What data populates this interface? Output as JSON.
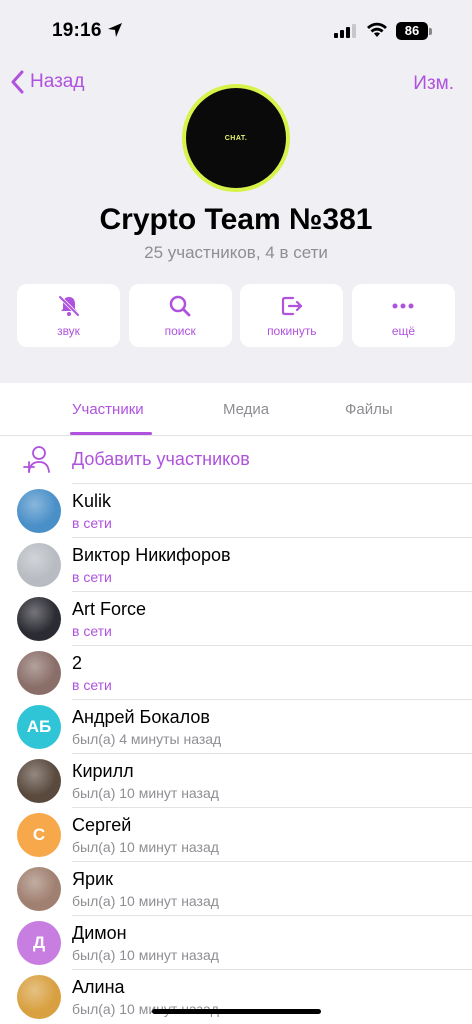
{
  "status_bar": {
    "time": "19:16",
    "battery": "86"
  },
  "nav": {
    "back_label": "Назад",
    "edit_label": "Изм."
  },
  "group": {
    "avatar_text": "CHAT.",
    "title": "Crypto Team №381",
    "subtitle": "25 участников, 4 в сети"
  },
  "actions": [
    {
      "label": "звук",
      "icon": "bell-slash-icon"
    },
    {
      "label": "поиск",
      "icon": "search-icon"
    },
    {
      "label": "покинуть",
      "icon": "leave-icon"
    },
    {
      "label": "ещё",
      "icon": "more-icon"
    }
  ],
  "tabs": [
    {
      "label": "Участники",
      "active": true
    },
    {
      "label": "Медиа",
      "active": false
    },
    {
      "label": "Файлы",
      "active": false
    }
  ],
  "add_members_label": "Добавить участников",
  "members": [
    {
      "name": "Kulik",
      "status": "в сети",
      "online": true,
      "avatar_color": "#4a90c8",
      "initials": ""
    },
    {
      "name": "Виктор Никифоров",
      "status": "в сети",
      "online": true,
      "avatar_color": "#b8bcc2",
      "initials": ""
    },
    {
      "name": "Art Force",
      "status": "в сети",
      "online": true,
      "avatar_color": "#2b2b33",
      "initials": ""
    },
    {
      "name": "2",
      "status": "в сети",
      "online": true,
      "avatar_color": "#8a6e68",
      "initials": ""
    },
    {
      "name": "Андрей Бокалов",
      "status": "был(а) 4 минуты назад",
      "online": false,
      "avatar_color": "#2fc4d6",
      "initials": "АБ"
    },
    {
      "name": "Кирилл",
      "status": "был(а) 10 минут назад",
      "online": false,
      "avatar_color": "#5a4a3e",
      "initials": ""
    },
    {
      "name": "Сергей",
      "status": "был(а) 10 минут назад",
      "online": false,
      "avatar_color": "#f7a84a",
      "initials": "С"
    },
    {
      "name": "Ярик",
      "status": "был(а) 10 минут назад",
      "online": false,
      "avatar_color": "#a08070",
      "initials": ""
    },
    {
      "name": "Димон",
      "status": "был(а) 10 минут назад",
      "online": false,
      "avatar_color": "#c77ee0",
      "initials": "Д"
    },
    {
      "name": "Алина",
      "status": "был(а) 10 минут назад",
      "online": false,
      "avatar_color": "#d8a040",
      "initials": ""
    }
  ],
  "colors": {
    "accent": "#af52de",
    "secondary_text": "#8e8e93",
    "background": "#efeff4"
  }
}
